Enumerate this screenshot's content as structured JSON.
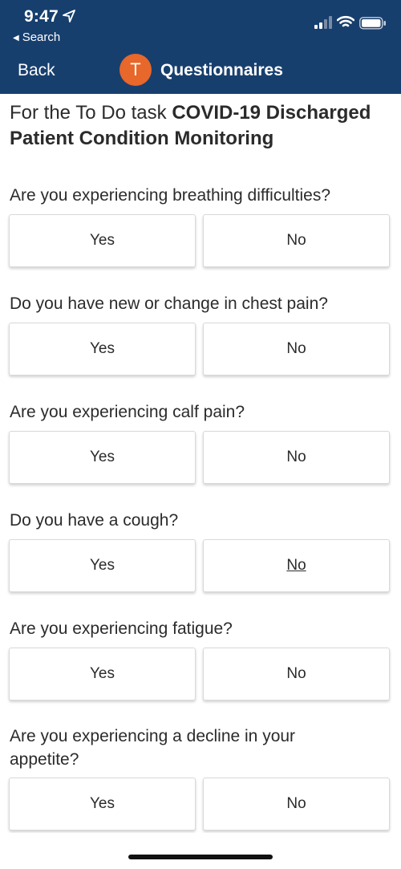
{
  "status_bar": {
    "time": "9:47",
    "back_label": "Search",
    "location_icon": "location-arrow-icon",
    "signal_icon": "cellular-signal-icon",
    "wifi_icon": "wifi-icon",
    "battery_icon": "battery-icon"
  },
  "nav": {
    "back_label": "Back",
    "avatar_initial": "T",
    "avatar_color": "#e8672a",
    "title": "Questionnaires",
    "background_color": "#173f6e"
  },
  "task": {
    "prefix": "For the To Do task ",
    "name": "COVID-19 Discharged Patient Condition Monitoring"
  },
  "questions": [
    {
      "text": "Are you experiencing breathing difficulties?",
      "yes_label": "Yes",
      "no_label": "No"
    },
    {
      "text": "Do you have new or change in chest pain?",
      "yes_label": "Yes",
      "no_label": "No"
    },
    {
      "text": "Are you experiencing calf pain?",
      "yes_label": "Yes",
      "no_label": "No"
    },
    {
      "text": "Do you have a cough?",
      "yes_label": "Yes",
      "no_label": "No"
    },
    {
      "text": "Are you experiencing fatigue?",
      "yes_label": "Yes",
      "no_label": "No"
    },
    {
      "text": "Are you experiencing a decline in your appetite?",
      "yes_label": "Yes",
      "no_label": "No"
    }
  ]
}
